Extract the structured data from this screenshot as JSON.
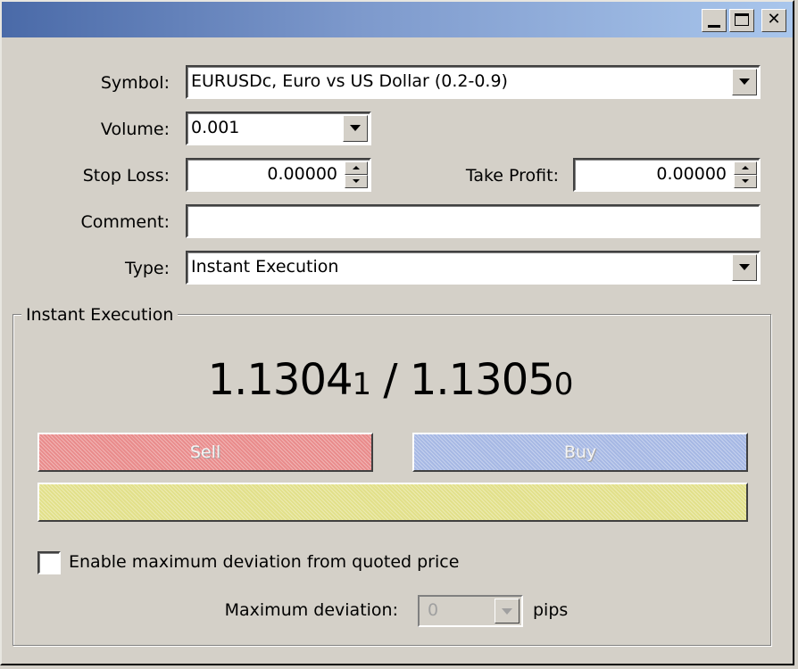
{
  "window": {
    "controls": [
      "minimize",
      "maximize",
      "close"
    ],
    "close_glyph": "✕"
  },
  "form": {
    "symbol_label": "Symbol:",
    "symbol_value": "EURUSDc, Euro vs US Dollar (0.2-0.9)",
    "volume_label": "Volume:",
    "volume_value": "0.001",
    "stop_loss_label": "Stop Loss:",
    "stop_loss_value": "0.00000",
    "take_profit_label": "Take Profit:",
    "take_profit_value": "0.00000",
    "comment_label": "Comment:",
    "comment_value": "",
    "type_label": "Type:",
    "type_value": "Instant Execution"
  },
  "execution": {
    "group_title": "Instant Execution",
    "bid_main": "1.1304",
    "bid_last": "1",
    "separator": " / ",
    "ask_main": "1.1305",
    "ask_last": "0",
    "sell_label": "Sell",
    "buy_label": "Buy",
    "close_label": "",
    "enable_deviation_label": "Enable maximum deviation from quoted price",
    "enable_deviation_checked": false,
    "max_deviation_label": "Maximum deviation:",
    "max_deviation_value": "0",
    "pips_label": "pips"
  },
  "colors": {
    "sell": "#e98c8c",
    "buy": "#a6b8e4",
    "close": "#e2e08a",
    "titlebar_start": "#4a6aa8",
    "titlebar_end": "#a9c6ec"
  }
}
